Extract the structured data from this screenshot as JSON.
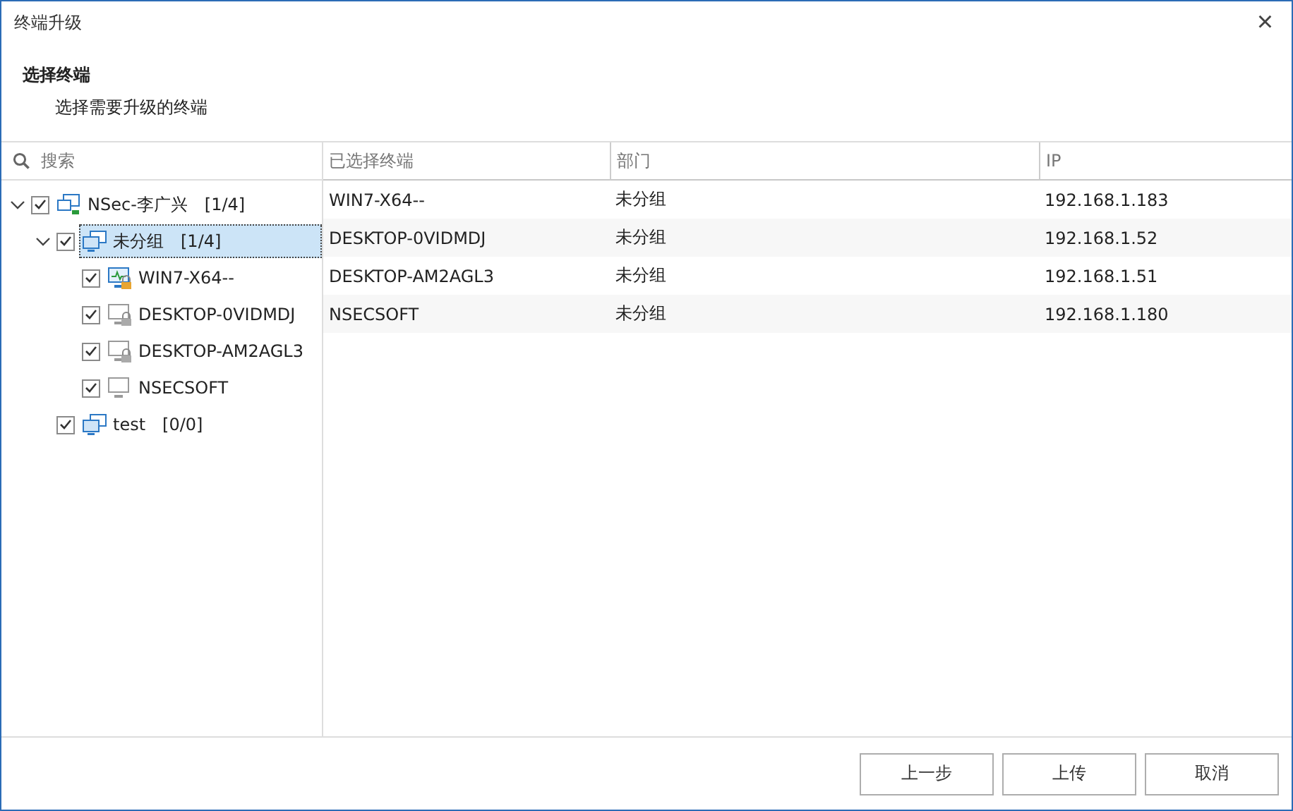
{
  "window": {
    "title": "终端升级",
    "close": "×"
  },
  "header": {
    "title": "选择终端",
    "subtitle": "选择需要升级的终端"
  },
  "search": {
    "placeholder": "搜索"
  },
  "tree": [
    {
      "label": "NSec-李广兴",
      "count": "[1/4]",
      "kind": "network",
      "checked": true,
      "expanded": true,
      "selected": false,
      "children": [
        {
          "label": "未分组",
          "count": "[1/4]",
          "kind": "group",
          "checked": true,
          "expanded": true,
          "selected": true,
          "children": [
            {
              "label": "WIN7-X64--",
              "kind": "computer",
              "online": true,
              "locked": true,
              "checked": true,
              "selected": false
            },
            {
              "label": "DESKTOP-0VIDMDJ",
              "kind": "computer",
              "online": false,
              "locked": true,
              "checked": true,
              "selected": false
            },
            {
              "label": "DESKTOP-AM2AGL3",
              "kind": "computer",
              "online": false,
              "locked": true,
              "checked": true,
              "selected": false
            },
            {
              "label": "NSECSOFT",
              "kind": "computer",
              "online": false,
              "locked": false,
              "checked": true,
              "selected": false
            }
          ]
        },
        {
          "label": "test",
          "count": "[0/0]",
          "kind": "group",
          "checked": true,
          "selected": false
        }
      ]
    }
  ],
  "table": {
    "columns": [
      "已选择终端",
      "部门",
      "IP"
    ],
    "rows": [
      [
        "WIN7-X64--",
        "未分组",
        "192.168.1.183"
      ],
      [
        "DESKTOP-0VIDMDJ",
        "未分组",
        "192.168.1.52"
      ],
      [
        "DESKTOP-AM2AGL3",
        "未分组",
        "192.168.1.51"
      ],
      [
        "NSECSOFT",
        "未分组",
        "192.168.1.180"
      ]
    ]
  },
  "buttons": [
    "上一步",
    "上传",
    "取消"
  ]
}
